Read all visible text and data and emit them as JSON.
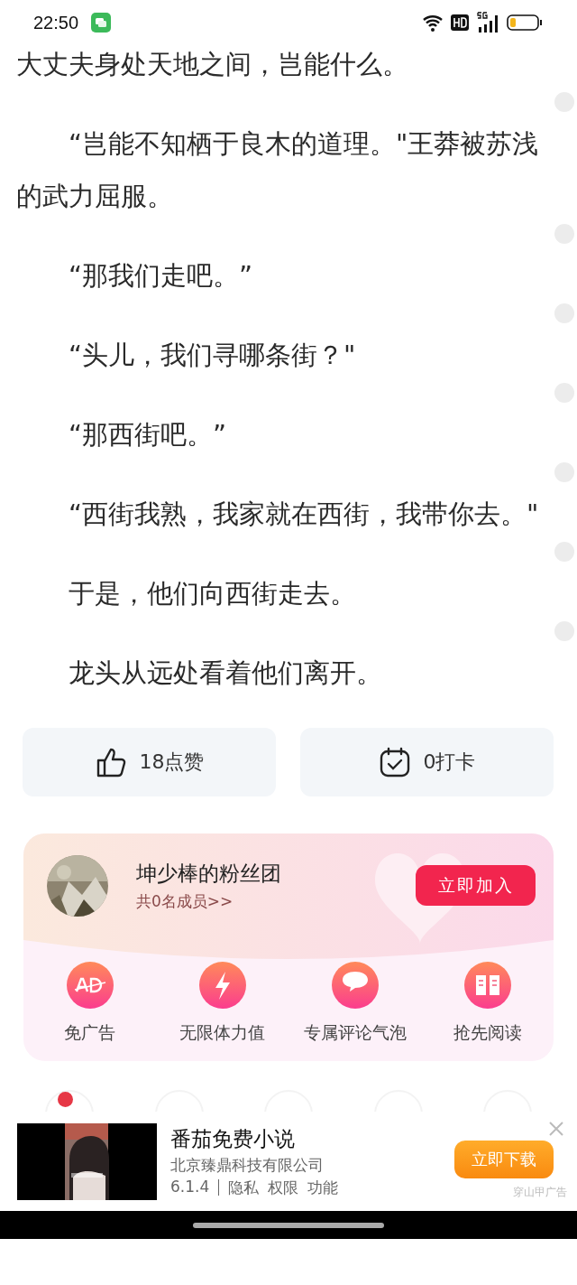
{
  "status_bar": {
    "time": "22:50"
  },
  "paragraphs": [
    {
      "text": "大丈夫身处天地之间，岂能什么。",
      "indent": false,
      "comment_marker": false
    },
    {
      "text": "“岂能不知栖于良木的道理。\"王莽被苏浅的武力屈服。",
      "indent": true,
      "comment_marker": true
    },
    {
      "text": "“那我们走吧。”",
      "indent": true,
      "comment_marker": true
    },
    {
      "text": "“头儿，我们寻哪条街？\"",
      "indent": true,
      "comment_marker": true
    },
    {
      "text": "“那西街吧。”",
      "indent": true,
      "comment_marker": true
    },
    {
      "text": "“西街我熟，我家就在西街，我带你去。\"",
      "indent": true,
      "comment_marker": true
    },
    {
      "text": "于是，他们向西街走去。",
      "indent": true,
      "comment_marker": true
    },
    {
      "text": "龙头从远处看着他们离开。",
      "indent": true,
      "comment_marker": true
    }
  ],
  "actions": [
    {
      "kind": "like",
      "label": "18点赞"
    },
    {
      "kind": "checkin",
      "label": "0打卡"
    }
  ],
  "fan_club": {
    "name": "坤少棒的粉丝团",
    "members": "共0名成员>>",
    "join_button": "立即加入",
    "perks": [
      {
        "kind": "ad",
        "label": "免广告"
      },
      {
        "kind": "bolt",
        "label": "无限体力值"
      },
      {
        "kind": "bubble",
        "label": "专属评论气泡"
      },
      {
        "kind": "book",
        "label": "抢先阅读"
      }
    ]
  },
  "toolbar": [
    {
      "badge": true
    },
    {
      "badge": false
    },
    {
      "badge": false
    },
    {
      "badge": false
    },
    {
      "badge": false
    }
  ],
  "ad": {
    "title": "番茄免费小说",
    "company": "北京臻鼎科技有限公司",
    "version": "6.1.4",
    "links": [
      "隐私",
      "权限",
      "功能"
    ],
    "button": "立即下载",
    "source": "穿山甲广告"
  }
}
